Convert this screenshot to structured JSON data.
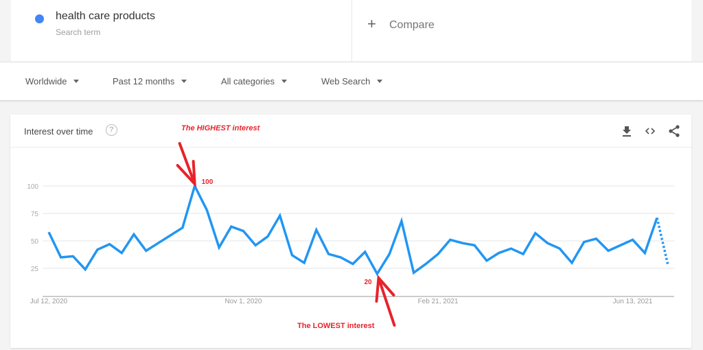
{
  "search_term": {
    "name": "health care products",
    "subtitle": "Search term",
    "color": "#4285f4"
  },
  "compare": {
    "icon": "plus-icon",
    "label": "Compare"
  },
  "filters": [
    {
      "label": "Worldwide"
    },
    {
      "label": "Past 12 months"
    },
    {
      "label": "All categories"
    },
    {
      "label": "Web Search"
    }
  ],
  "panel": {
    "title": "Interest over time",
    "help_icon": "?",
    "actions": [
      "download-icon",
      "embed-icon",
      "share-icon"
    ]
  },
  "annotations": {
    "highest_label": "The HIGHEST interest",
    "highest_value": "100",
    "lowest_label": "The LOWEST interest",
    "lowest_value": "20",
    "color": "#e8222b"
  },
  "chart_data": {
    "type": "line",
    "title": "Interest over time",
    "xlabel": "",
    "ylabel": "",
    "ylim": [
      0,
      100
    ],
    "yticks": [
      25,
      50,
      75,
      100
    ],
    "xtick_labels": [
      "Jul 12, 2020",
      "Nov 1, 2020",
      "Feb 21, 2021",
      "Jun 13, 2021"
    ],
    "xtick_indices": [
      0,
      16,
      32,
      48
    ],
    "grid": true,
    "legend": "none",
    "series": [
      {
        "name": "health care products",
        "color": "#2196f3",
        "values": [
          58,
          35,
          36,
          24,
          42,
          47,
          39,
          56,
          41,
          48,
          55,
          62,
          100,
          78,
          44,
          63,
          59,
          46,
          54,
          73,
          37,
          30,
          60,
          38,
          35,
          29,
          40,
          20,
          38,
          68,
          21,
          29,
          38,
          51,
          48,
          46,
          32,
          39,
          43,
          38,
          57,
          48,
          43,
          30,
          49,
          52,
          41,
          46,
          51,
          39,
          71
        ],
        "partial_last_value": 28
      }
    ]
  }
}
